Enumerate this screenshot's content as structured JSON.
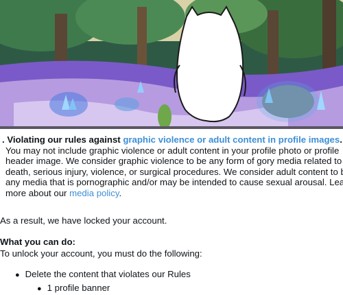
{
  "banner": {
    "description_icon": "cartoon-ghost-character-banner"
  },
  "violation": {
    "prefix": ". Violating our rules against ",
    "link": "graphic violence or adult content in profile images",
    "suffix": ".",
    "body_text": "You may not include graphic violence or adult content in your profile photo or profile header image. We consider graphic violence to be any form of gory media related to death, serious injury, violence, or surgical procedures. We consider adult content to be any media that is pornographic and/or may be intended to cause sexual arousal. Learn more about our ",
    "body_link": "media policy",
    "body_suffix": "."
  },
  "result": "As a result, we have locked your account.",
  "what_you_can_do": {
    "heading": "What you can do:",
    "instructions": "To unlock your account, you must do the following:",
    "steps": [
      {
        "label": "Delete the content that violates our Rules",
        "sub_items": [
          "1 profile banner"
        ]
      }
    ]
  },
  "colors": {
    "link": "#3d8fd6",
    "text": "#0f1419"
  }
}
